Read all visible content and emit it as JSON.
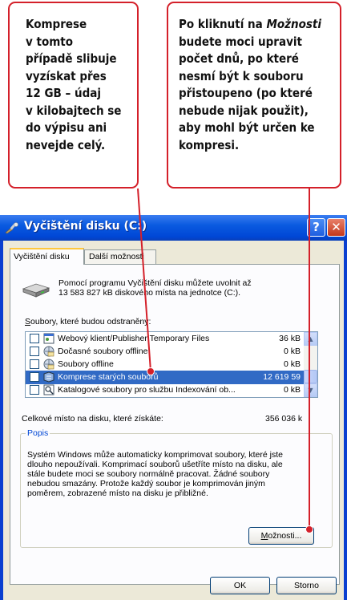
{
  "callouts": {
    "left": {
      "lines": [
        "Komprese",
        "v tomto",
        "případě slibuje",
        "vyzískat přes",
        "12 GB – údaj",
        "v kilobajtech se",
        "do výpisu ani",
        "nevejde celý."
      ]
    },
    "right": {
      "line1_pre": "Po kliknutí na ",
      "line1_em": "Možnosti",
      "lines_rest": [
        "budete moci upravit",
        "počet dnů, po které",
        "nesmí být k souboru",
        "přistoupeno (po které",
        "nebude nijak použit),",
        "aby mohl být určen ke",
        "kompresi."
      ]
    },
    "color": "#d4202a"
  },
  "window": {
    "title": "Vyčištění disku  (C:)",
    "help_label": "?",
    "close_label": "✕"
  },
  "tabs": {
    "active": "Vyčištění disku",
    "inactive": "Další možnosti"
  },
  "intro": {
    "line1": "Pomocí programu Vyčištění disku můžete uvolnit až",
    "line2": "13 583 827 kB diskového místa na jednotce  (C:)."
  },
  "list": {
    "header_u": "S",
    "header_rest": "oubory, které budou odstraněny:",
    "items": [
      {
        "name": "Webový klient/Publisher Temporary Files",
        "size": "36 kB",
        "icon": "web-page-icon",
        "checked": false,
        "selected": false
      },
      {
        "name": "Dočasné soubory offline",
        "size": "0 kB",
        "icon": "offline-files-icon",
        "checked": false,
        "selected": false
      },
      {
        "name": "Soubory offline",
        "size": "0 kB",
        "icon": "offline-files-icon",
        "checked": false,
        "selected": false
      },
      {
        "name": "Komprese starých souborů",
        "size": "12 619 59",
        "icon": "compress-icon",
        "checked": false,
        "selected": true
      },
      {
        "name": "Katalogové soubory pro službu Indexování ob...",
        "size": "0 kB",
        "icon": "catalog-icon",
        "checked": false,
        "selected": false
      }
    ]
  },
  "total": {
    "label": "Celkové místo na disku, které získáte:",
    "value": "356 036 k"
  },
  "description": {
    "label": "Popis",
    "lines": [
      "Systém Windows může automaticky komprimovat soubory, které jste",
      "dlouho nepoužívali. Komprimací souborů ušetříte místo na disku, ale",
      "stále budete moci se soubory normálně pracovat. Žádné soubory",
      "nebudou smazány. Protože každý soubor je komprimován jiným",
      "poměrem, zobrazené místo na disku je přibližné."
    ]
  },
  "buttons": {
    "options_u": "M",
    "options_rest": "ožnosti...",
    "ok": "OK",
    "cancel": "Storno"
  },
  "colors": {
    "titlebar": "#0a5ae0",
    "selection": "#316ac5",
    "dialog_bg": "#ece9d8"
  }
}
